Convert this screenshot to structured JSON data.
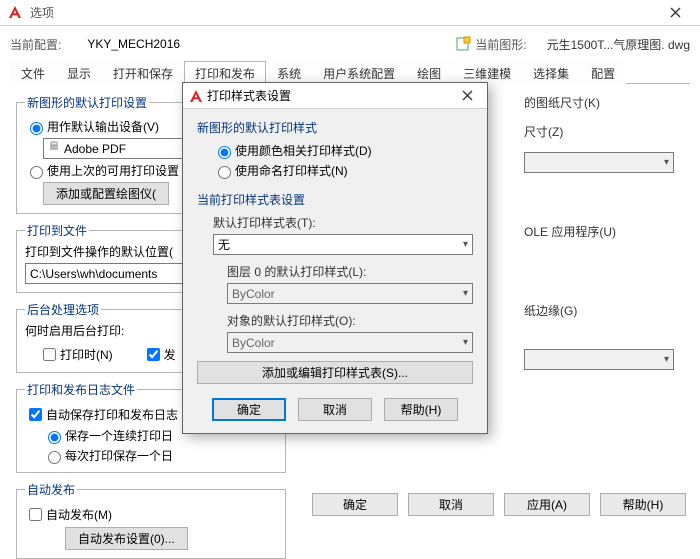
{
  "window": {
    "title": "选项"
  },
  "profile": {
    "current_label": "当前配置:",
    "current_value": "YKY_MECH2016",
    "drawing_label": "当前图形:",
    "drawing_value": "元生1500T...气原理图. dwg"
  },
  "tabs": [
    "文件",
    "显示",
    "打开和保存",
    "打印和发布",
    "系统",
    "用户系统配置",
    "绘图",
    "三维建模",
    "选择集",
    "配置"
  ],
  "active_tab": 3,
  "bg": {
    "sec1_title": "新图形的默认打印设置",
    "radio_default_device": "用作默认输出设备(V)",
    "device_combo_value": "Adobe PDF",
    "radio_last": "使用上次的可用打印设置",
    "btn_config_plotter": "添加或配置绘图仪(",
    "sec2_title": "打印到文件",
    "sec2_label": "打印到文件操作的默认位置(",
    "path_value": "C:\\Users\\wh\\documents",
    "sec3_title": "后台处理选项",
    "sec3_label": "何时启用后台打印:",
    "chk_print": "打印时(N)",
    "chk_publish": "发",
    "sec4_title": "打印和发布日志文件",
    "chk_autosave_log": "自动保存打印和发布日志",
    "radio_one_log": "保存一个连续打印日",
    "radio_each_log": "每次打印保存一个日",
    "sec5_title": "自动发布",
    "chk_autopub": "自动发布(M)",
    "btn_autopub_settings": "自动发布设置(0)...",
    "right_paper": "的图纸尺寸(K)",
    "right_size": "尺寸(Z)",
    "right_ole": "OLE 应用程序(U)",
    "right_edge": "纸边缘(G)"
  },
  "dlg": {
    "title": "打印样式表设置",
    "grp1_title": "新图形的默认打印样式",
    "radio_color": "使用颜色相关打印样式(D)",
    "radio_named": "使用命名打印样式(N)",
    "grp2_title": "当前打印样式表设置",
    "lbl_default_table": "默认打印样式表(T):",
    "combo_table_value": "无",
    "lbl_layer0": "图层 0 的默认打印样式(L):",
    "combo_layer0_value": "ByColor",
    "lbl_object": "对象的默认打印样式(O):",
    "combo_object_value": "ByColor",
    "btn_add_edit": "添加或编辑打印样式表(S)...",
    "btn_ok": "确定",
    "btn_cancel": "取消",
    "btn_help": "帮助(H)"
  },
  "main_buttons": {
    "ok": "确定",
    "cancel": "取消",
    "apply": "应用(A)",
    "help": "帮助(H)"
  }
}
